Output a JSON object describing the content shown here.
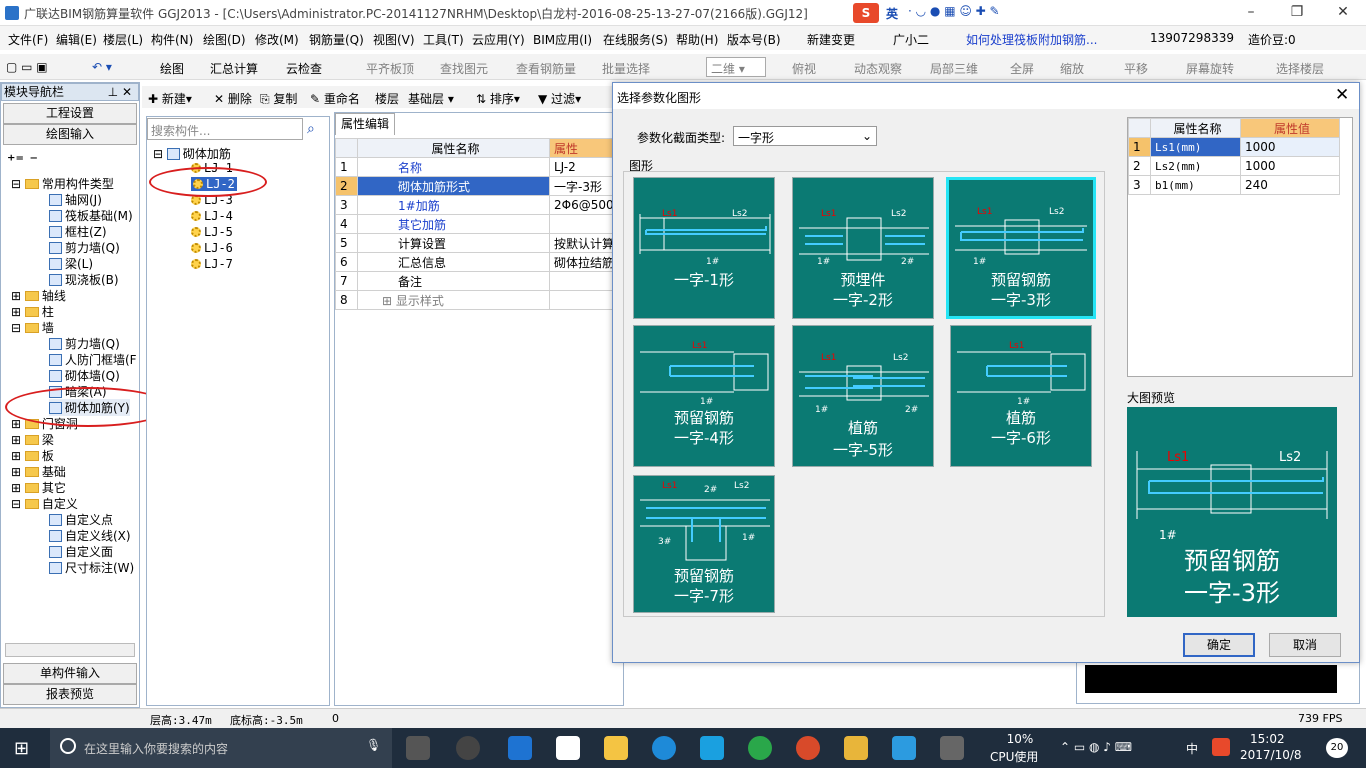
{
  "window": {
    "title": "广联达BIM钢筋算量软件 GGJ2013 - [C:\\Users\\Administrator.PC-20141127NRHM\\Desktop\\白龙村-2016-08-25-13-27-07(2166版).GGJ12]",
    "ime": "英"
  },
  "menu": [
    "文件(F)",
    "编辑(E)",
    "楼层(L)",
    "构件(N)",
    "绘图(D)",
    "修改(M)",
    "钢筋量(Q)",
    "视图(V)",
    "工具(T)",
    "云应用(Y)",
    "BIM应用(I)",
    "在线服务(S)",
    "帮助(H)",
    "版本号(B)",
    "新建变更",
    "广小二",
    "如何处理筏板附加钢筋...",
    "13907298339",
    "造价豆:0"
  ],
  "toolbar": [
    "绘图",
    "汇总计算",
    "云检查",
    "平齐板顶",
    "查找图元",
    "查看钢筋量",
    "批量选择",
    "二维",
    "俯视",
    "动态观察",
    "局部三维",
    "全屏",
    "缩放",
    "平移",
    "屏幕旋转",
    "选择楼层"
  ],
  "toolbar2": [
    "新建",
    "删除",
    "复制",
    "重命名",
    "楼层",
    "基础层",
    "排序",
    "过滤"
  ],
  "nav": {
    "title": "模块导航栏",
    "btn_project": "工程设置",
    "btn_draw": "绘图输入",
    "btn_single": "单构件输入",
    "btn_report": "报表预览",
    "tree": [
      "常用构件类型",
      "轴网(J)",
      "筏板基础(M)",
      "框柱(Z)",
      "剪力墙(Q)",
      "梁(L)",
      "现浇板(B)",
      "轴线",
      "柱",
      "墙",
      "剪力墙(Q)",
      "人防门框墙(F",
      "砌体墙(Q)",
      "暗梁(A)",
      "砌体加筋(Y)",
      "门窗洞",
      "梁",
      "板",
      "基础",
      "其它",
      "自定义",
      "自定义点",
      "自定义线(X)",
      "自定义面",
      "尺寸标注(W)"
    ]
  },
  "search": {
    "placeholder": "搜索构件..."
  },
  "comp_tree": {
    "root": "砌体加筋",
    "items": [
      "LJ-1",
      "LJ-2",
      "LJ-3",
      "LJ-4",
      "LJ-5",
      "LJ-6",
      "LJ-7"
    ]
  },
  "prop": {
    "tab": "属性编辑",
    "col_name": "属性名称",
    "col_val": "属性",
    "rows": [
      {
        "n": "1",
        "name": "名称",
        "val": "LJ-2"
      },
      {
        "n": "2",
        "name": "砌体加筋形式",
        "val": "一字-3形"
      },
      {
        "n": "3",
        "name": "1#加筋",
        "val": "2Φ6@500"
      },
      {
        "n": "4",
        "name": "其它加筋",
        "val": ""
      },
      {
        "n": "5",
        "name": "计算设置",
        "val": "按默认计算"
      },
      {
        "n": "6",
        "name": "汇总信息",
        "val": "砌体拉结筋"
      },
      {
        "n": "7",
        "name": "备注",
        "val": ""
      },
      {
        "n": "8",
        "name": "显示样式",
        "val": ""
      }
    ]
  },
  "dialog": {
    "title": "选择参数化图形",
    "section_label": "参数化截面类型:",
    "section_value": "一字形",
    "group_label": "图形",
    "tiles": [
      {
        "l1": "一字-1形",
        "l2": ""
      },
      {
        "l1": "预埋件",
        "l2": "一字-2形"
      },
      {
        "l1": "预留钢筋",
        "l2": "一字-3形"
      },
      {
        "l1": "预留钢筋",
        "l2": "一字-4形"
      },
      {
        "l1": "植筋",
        "l2": "一字-5形"
      },
      {
        "l1": "植筋",
        "l2": "一字-6形"
      },
      {
        "l1": "预留钢筋",
        "l2": "一字-7形"
      }
    ],
    "param_col_name": "属性名称",
    "param_col_val": "属性值",
    "params": [
      {
        "n": "1",
        "name": "Ls1(mm)",
        "val": "1000"
      },
      {
        "n": "2",
        "name": "Ls2(mm)",
        "val": "1000"
      },
      {
        "n": "3",
        "name": "b1(mm)",
        "val": "240"
      }
    ],
    "preview_label": "大图预览",
    "preview_l1": "预留钢筋",
    "preview_l2": "一字-3形",
    "ok": "确定",
    "cancel": "取消"
  },
  "status": {
    "floor_h": "层高:3.47m",
    "base_h": "底标高:-3.5m",
    "zero": "0",
    "fps": "739 FPS"
  },
  "taskbar": {
    "search": "在这里输入你要搜索的内容",
    "cpu": "10%",
    "cpu_label": "CPU使用",
    "lang": "中",
    "time": "15:02",
    "date": "2017/10/8",
    "notif": "20"
  }
}
